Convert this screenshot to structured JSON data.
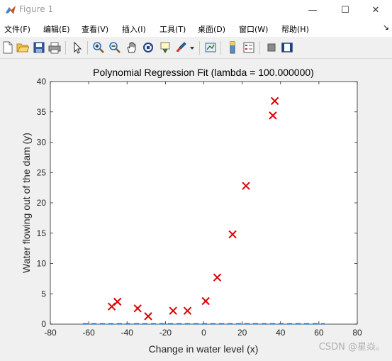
{
  "window": {
    "title": "Figure 1",
    "minimize": "—",
    "maximize": "☐",
    "close": "✕"
  },
  "menu": {
    "items": [
      "文件(F)",
      "编辑(E)",
      "查看(V)",
      "插入(I)",
      "工具(T)",
      "桌面(D)",
      "窗口(W)",
      "帮助(H)"
    ],
    "overflow": "↘"
  },
  "toolbar": {
    "icons": [
      "new-figure-icon",
      "open-file-icon",
      "save-icon",
      "print-icon",
      "select-arrow-icon",
      "zoom-in-icon",
      "zoom-out-icon",
      "pan-hand-icon",
      "rotate-3d-icon",
      "data-cursor-icon",
      "brush-icon",
      "brush-dropdown-icon",
      "link-plot-icon",
      "colorbar-icon",
      "legend-icon",
      "hide-plot-tools-icon",
      "show-plot-tools-icon"
    ]
  },
  "chart_data": {
    "type": "scatter",
    "title": "Polynomial Regression Fit (lambda = 100.000000)",
    "xlabel": "Change in water level (x)",
    "ylabel": "Water flowing out of the dam (y)",
    "xlim": [
      -80,
      80
    ],
    "ylim": [
      0,
      40
    ],
    "xticks": [
      -80,
      -60,
      -40,
      -20,
      0,
      20,
      40,
      60,
      80
    ],
    "yticks": [
      0,
      5,
      10,
      15,
      20,
      25,
      30,
      35,
      40
    ],
    "grid": false,
    "series": [
      {
        "marker": "x",
        "color": "#e00000",
        "points": [
          [
            -48,
            2.9
          ],
          [
            -45,
            3.7
          ],
          [
            -34.5,
            2.6
          ],
          [
            -29,
            1.3
          ],
          [
            -16,
            2.2
          ],
          [
            -8.5,
            2.2
          ],
          [
            1,
            3.8
          ],
          [
            7,
            7.7
          ],
          [
            15,
            14.8
          ],
          [
            22,
            22.8
          ],
          [
            36,
            34.4
          ],
          [
            37,
            36.8
          ]
        ]
      },
      {
        "style": "dashed-line",
        "color": "#1f77d0",
        "x": [
          -63,
          63
        ],
        "y": [
          0.05,
          0.05
        ]
      }
    ]
  },
  "watermark": "CSDN @星焱。"
}
